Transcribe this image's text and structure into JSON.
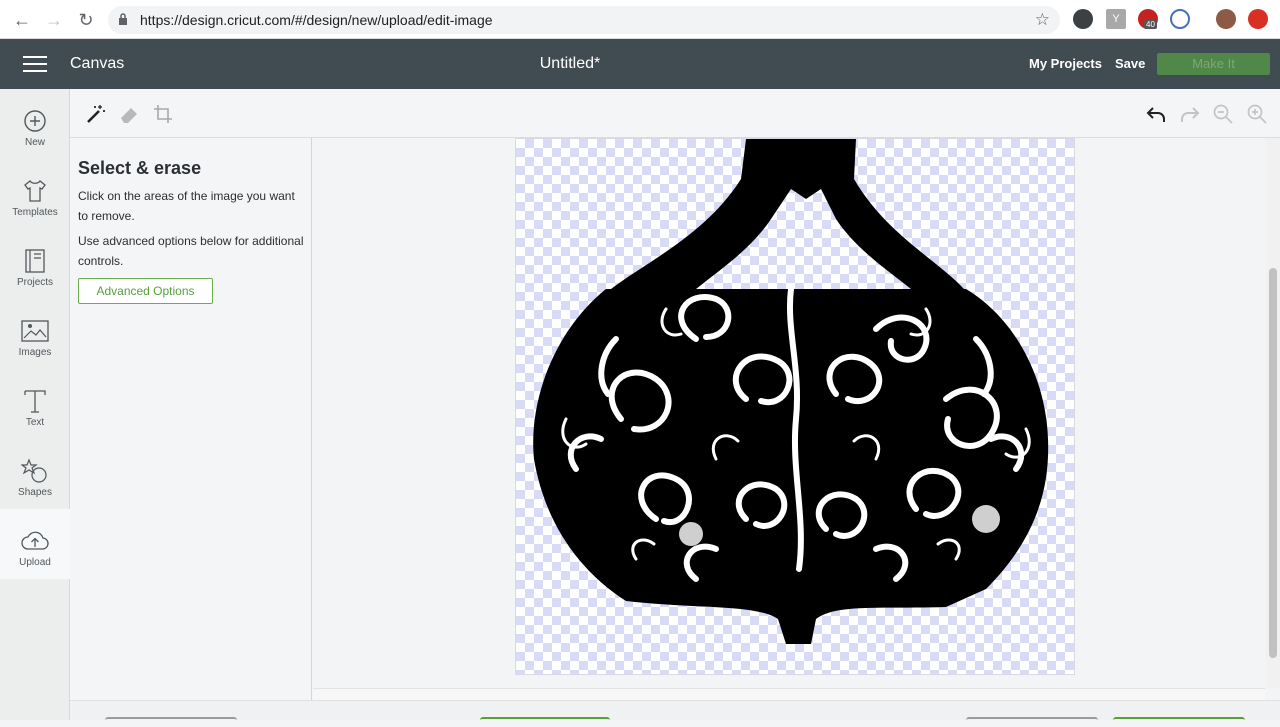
{
  "browser": {
    "url": "https://design.cricut.com/#/design/new/upload/edit-image",
    "ext_badge": "40"
  },
  "header": {
    "app_name": "Canvas",
    "doc_title": "Untitled*",
    "my_projects": "My Projects",
    "save": "Save",
    "make_it": "Make It"
  },
  "sidebar": {
    "items": [
      {
        "label": "New",
        "icon": "plus-circle-icon"
      },
      {
        "label": "Templates",
        "icon": "tshirt-icon"
      },
      {
        "label": "Projects",
        "icon": "projects-icon"
      },
      {
        "label": "Images",
        "icon": "image-icon"
      },
      {
        "label": "Text",
        "icon": "text-icon"
      },
      {
        "label": "Shapes",
        "icon": "shapes-icon"
      },
      {
        "label": "Upload",
        "icon": "upload-cloud-icon"
      }
    ]
  },
  "panel": {
    "title": "Select & erase",
    "desc1": "Click on the areas of the image you want to remove.",
    "desc2": "Use advanced options below for additional controls.",
    "advanced": "Advanced Options"
  },
  "colors": {
    "header_bg": "#414b52",
    "accent_green": "#57a03a",
    "checker_tint": "#d9daf5"
  }
}
